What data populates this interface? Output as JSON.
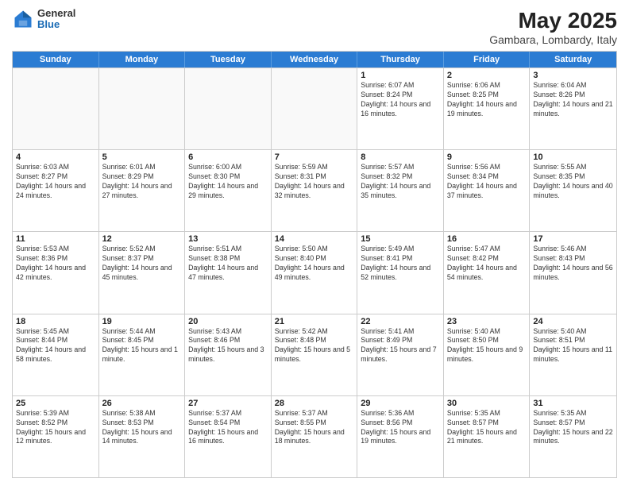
{
  "header": {
    "logo_general": "General",
    "logo_blue": "Blue",
    "title": "May 2025",
    "subtitle": "Gambara, Lombardy, Italy"
  },
  "calendar": {
    "days_of_week": [
      "Sunday",
      "Monday",
      "Tuesday",
      "Wednesday",
      "Thursday",
      "Friday",
      "Saturday"
    ],
    "rows": [
      [
        {
          "day": "",
          "empty": true
        },
        {
          "day": "",
          "empty": true
        },
        {
          "day": "",
          "empty": true
        },
        {
          "day": "",
          "empty": true
        },
        {
          "day": "1",
          "sunrise": "6:07 AM",
          "sunset": "8:24 PM",
          "daylight": "14 hours and 16 minutes."
        },
        {
          "day": "2",
          "sunrise": "6:06 AM",
          "sunset": "8:25 PM",
          "daylight": "14 hours and 19 minutes."
        },
        {
          "day": "3",
          "sunrise": "6:04 AM",
          "sunset": "8:26 PM",
          "daylight": "14 hours and 21 minutes."
        }
      ],
      [
        {
          "day": "4",
          "sunrise": "6:03 AM",
          "sunset": "8:27 PM",
          "daylight": "14 hours and 24 minutes."
        },
        {
          "day": "5",
          "sunrise": "6:01 AM",
          "sunset": "8:29 PM",
          "daylight": "14 hours and 27 minutes."
        },
        {
          "day": "6",
          "sunrise": "6:00 AM",
          "sunset": "8:30 PM",
          "daylight": "14 hours and 29 minutes."
        },
        {
          "day": "7",
          "sunrise": "5:59 AM",
          "sunset": "8:31 PM",
          "daylight": "14 hours and 32 minutes."
        },
        {
          "day": "8",
          "sunrise": "5:57 AM",
          "sunset": "8:32 PM",
          "daylight": "14 hours and 35 minutes."
        },
        {
          "day": "9",
          "sunrise": "5:56 AM",
          "sunset": "8:34 PM",
          "daylight": "14 hours and 37 minutes."
        },
        {
          "day": "10",
          "sunrise": "5:55 AM",
          "sunset": "8:35 PM",
          "daylight": "14 hours and 40 minutes."
        }
      ],
      [
        {
          "day": "11",
          "sunrise": "5:53 AM",
          "sunset": "8:36 PM",
          "daylight": "14 hours and 42 minutes."
        },
        {
          "day": "12",
          "sunrise": "5:52 AM",
          "sunset": "8:37 PM",
          "daylight": "14 hours and 45 minutes."
        },
        {
          "day": "13",
          "sunrise": "5:51 AM",
          "sunset": "8:38 PM",
          "daylight": "14 hours and 47 minutes."
        },
        {
          "day": "14",
          "sunrise": "5:50 AM",
          "sunset": "8:40 PM",
          "daylight": "14 hours and 49 minutes."
        },
        {
          "day": "15",
          "sunrise": "5:49 AM",
          "sunset": "8:41 PM",
          "daylight": "14 hours and 52 minutes."
        },
        {
          "day": "16",
          "sunrise": "5:47 AM",
          "sunset": "8:42 PM",
          "daylight": "14 hours and 54 minutes."
        },
        {
          "day": "17",
          "sunrise": "5:46 AM",
          "sunset": "8:43 PM",
          "daylight": "14 hours and 56 minutes."
        }
      ],
      [
        {
          "day": "18",
          "sunrise": "5:45 AM",
          "sunset": "8:44 PM",
          "daylight": "14 hours and 58 minutes."
        },
        {
          "day": "19",
          "sunrise": "5:44 AM",
          "sunset": "8:45 PM",
          "daylight": "15 hours and 1 minute."
        },
        {
          "day": "20",
          "sunrise": "5:43 AM",
          "sunset": "8:46 PM",
          "daylight": "15 hours and 3 minutes."
        },
        {
          "day": "21",
          "sunrise": "5:42 AM",
          "sunset": "8:48 PM",
          "daylight": "15 hours and 5 minutes."
        },
        {
          "day": "22",
          "sunrise": "5:41 AM",
          "sunset": "8:49 PM",
          "daylight": "15 hours and 7 minutes."
        },
        {
          "day": "23",
          "sunrise": "5:40 AM",
          "sunset": "8:50 PM",
          "daylight": "15 hours and 9 minutes."
        },
        {
          "day": "24",
          "sunrise": "5:40 AM",
          "sunset": "8:51 PM",
          "daylight": "15 hours and 11 minutes."
        }
      ],
      [
        {
          "day": "25",
          "sunrise": "5:39 AM",
          "sunset": "8:52 PM",
          "daylight": "15 hours and 12 minutes."
        },
        {
          "day": "26",
          "sunrise": "5:38 AM",
          "sunset": "8:53 PM",
          "daylight": "15 hours and 14 minutes."
        },
        {
          "day": "27",
          "sunrise": "5:37 AM",
          "sunset": "8:54 PM",
          "daylight": "15 hours and 16 minutes."
        },
        {
          "day": "28",
          "sunrise": "5:37 AM",
          "sunset": "8:55 PM",
          "daylight": "15 hours and 18 minutes."
        },
        {
          "day": "29",
          "sunrise": "5:36 AM",
          "sunset": "8:56 PM",
          "daylight": "15 hours and 19 minutes."
        },
        {
          "day": "30",
          "sunrise": "5:35 AM",
          "sunset": "8:57 PM",
          "daylight": "15 hours and 21 minutes."
        },
        {
          "day": "31",
          "sunrise": "5:35 AM",
          "sunset": "8:57 PM",
          "daylight": "15 hours and 22 minutes."
        }
      ]
    ]
  }
}
